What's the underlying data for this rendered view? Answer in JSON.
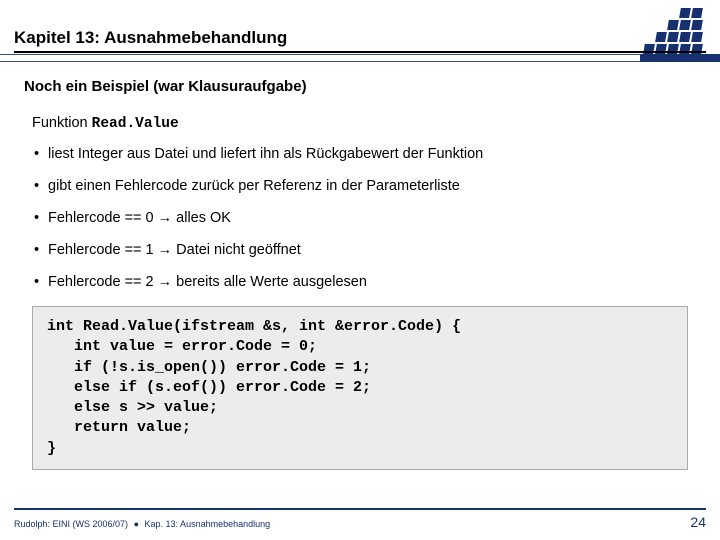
{
  "header": {
    "chapter_title": "Kapitel 13: Ausnahmebehandlung"
  },
  "section": {
    "title": "Noch ein Beispiel (war Klausuraufgabe)",
    "function_label": "Funktion",
    "function_name": "Read.Value"
  },
  "bullets": [
    "liest Integer aus Datei und liefert ihn als Rückgabewert der Funktion",
    "gibt einen Fehlercode zurück per Referenz in der Parameterliste",
    "Fehlercode == 0 → alles OK",
    "Fehlercode == 1 → Datei nicht geöffnet",
    "Fehlercode == 2 → bereits alle Werte ausgelesen"
  ],
  "code": "int Read.Value(ifstream &s, int &error.Code) {\n   int value = error.Code = 0;\n   if (!s.is_open()) error.Code = 1;\n   else if (s.eof()) error.Code = 2;\n   else s >> value;\n   return value;\n}",
  "footer": {
    "author": "Rudolph: EINI (WS 2006/07)",
    "separator": "●",
    "chapter_ref": "Kap. 13: Ausnahmebehandlung",
    "page": "24"
  }
}
